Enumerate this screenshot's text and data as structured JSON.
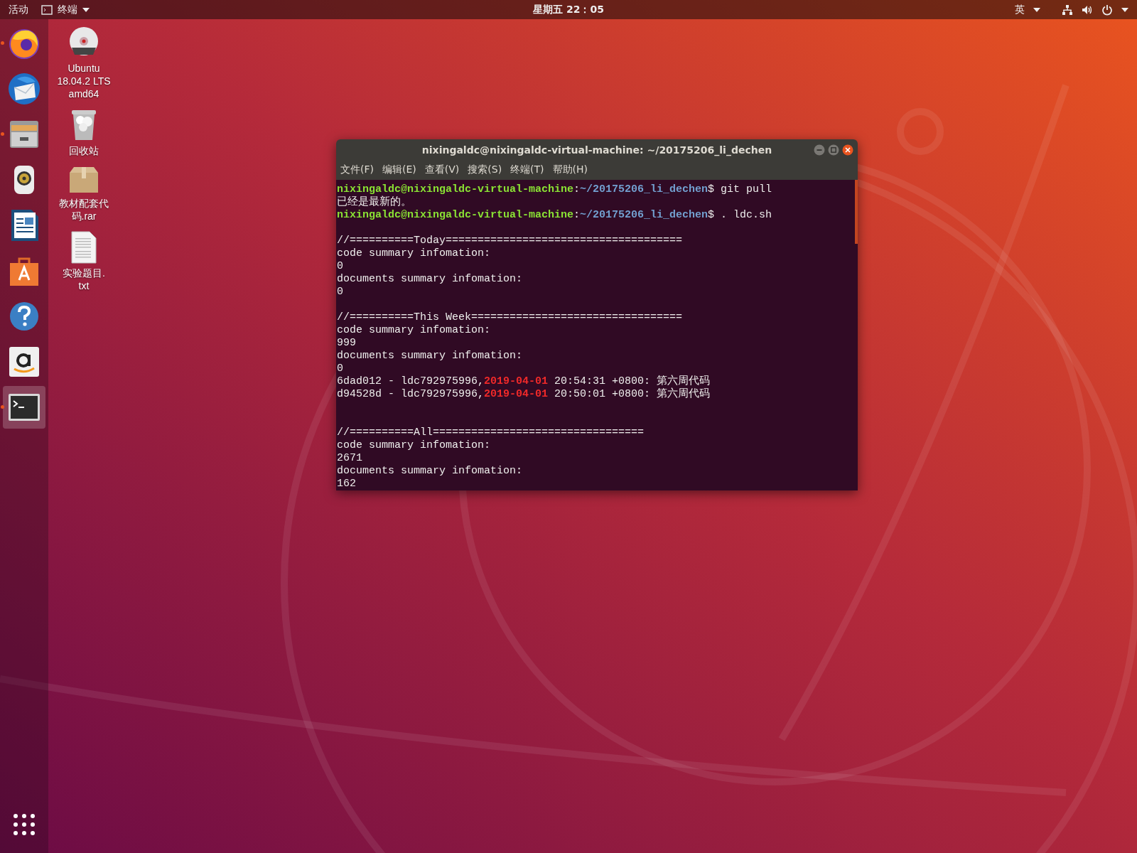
{
  "top_bar": {
    "activities": "活动",
    "app_menu": "终端",
    "clock": "星期五 22：05",
    "input_method": "英"
  },
  "dock": {
    "items": [
      {
        "kind": "browser",
        "running": true,
        "selected": false
      },
      {
        "kind": "mail",
        "running": false,
        "selected": false
      },
      {
        "kind": "files",
        "running": true,
        "selected": false
      },
      {
        "kind": "music",
        "running": false,
        "selected": false
      },
      {
        "kind": "writer",
        "running": false,
        "selected": false
      },
      {
        "kind": "store",
        "running": false,
        "selected": false
      },
      {
        "kind": "help",
        "running": false,
        "selected": false
      },
      {
        "kind": "shop",
        "running": false,
        "selected": false
      },
      {
        "kind": "terminal",
        "running": true,
        "selected": true
      }
    ]
  },
  "desktop_icons": [
    {
      "kind": "disc",
      "label": "Ubuntu\n18.04.2 LTS\namd64"
    },
    {
      "kind": "trash",
      "label": "回收站"
    },
    {
      "kind": "archive",
      "label": "教材配套代码.rar"
    },
    {
      "kind": "document",
      "label": "实验题目.\ntxt"
    }
  ],
  "terminal": {
    "title": "nixingaldc@nixingaldc-virtual-machine: ~/20175206_li_dechen",
    "menu": [
      "文件(F)",
      "编辑(E)",
      "查看(V)",
      "搜索(S)",
      "终端(T)",
      "帮助(H)"
    ],
    "lines": [
      {
        "kind": "text",
        "segments": [
          {
            "kind": "user",
            "text": "nixingaldc@nixingaldc-virtual-machine"
          },
          {
            "kind": "plain",
            "text": ":"
          },
          {
            "kind": "path",
            "text": "~/20175206_li_dechen"
          },
          {
            "kind": "plain",
            "text": "$ git pull"
          }
        ]
      },
      {
        "kind": "text",
        "segments": [
          {
            "kind": "plain",
            "text": "已经是最新的。"
          }
        ]
      },
      {
        "kind": "text",
        "segments": [
          {
            "kind": "user",
            "text": "nixingaldc@nixingaldc-virtual-machine"
          },
          {
            "kind": "plain",
            "text": ":"
          },
          {
            "kind": "path",
            "text": "~/20175206_li_dechen"
          },
          {
            "kind": "plain",
            "text": "$ . ldc.sh"
          }
        ]
      },
      {
        "kind": "blank"
      },
      {
        "kind": "text",
        "segments": [
          {
            "kind": "plain",
            "text": "//==========Today====================================="
          }
        ]
      },
      {
        "kind": "text",
        "segments": [
          {
            "kind": "plain",
            "text": "code summary infomation:"
          }
        ]
      },
      {
        "kind": "text",
        "segments": [
          {
            "kind": "plain",
            "text": "0"
          }
        ]
      },
      {
        "kind": "text",
        "segments": [
          {
            "kind": "plain",
            "text": "documents summary infomation:"
          }
        ]
      },
      {
        "kind": "text",
        "segments": [
          {
            "kind": "plain",
            "text": "0"
          }
        ]
      },
      {
        "kind": "blank"
      },
      {
        "kind": "text",
        "segments": [
          {
            "kind": "plain",
            "text": "//==========This Week================================="
          }
        ]
      },
      {
        "kind": "text",
        "segments": [
          {
            "kind": "plain",
            "text": "code summary infomation:"
          }
        ]
      },
      {
        "kind": "text",
        "segments": [
          {
            "kind": "plain",
            "text": "999"
          }
        ]
      },
      {
        "kind": "text",
        "segments": [
          {
            "kind": "plain",
            "text": "documents summary infomation:"
          }
        ]
      },
      {
        "kind": "text",
        "segments": [
          {
            "kind": "plain",
            "text": "0"
          }
        ]
      },
      {
        "kind": "text",
        "segments": [
          {
            "kind": "plain",
            "text": "6dad012 - ldc792975996,"
          },
          {
            "kind": "date",
            "text": "2019-04-01"
          },
          {
            "kind": "plain",
            "text": " 20:54:31 +0800: 第六周代码"
          }
        ]
      },
      {
        "kind": "text",
        "segments": [
          {
            "kind": "plain",
            "text": "d94528d - ldc792975996,"
          },
          {
            "kind": "date",
            "text": "2019-04-01"
          },
          {
            "kind": "plain",
            "text": " 20:50:01 +0800: 第六周代码"
          }
        ]
      },
      {
        "kind": "blank"
      },
      {
        "kind": "blank"
      },
      {
        "kind": "text",
        "segments": [
          {
            "kind": "plain",
            "text": "//==========All================================="
          }
        ]
      },
      {
        "kind": "text",
        "segments": [
          {
            "kind": "plain",
            "text": "code summary infomation:"
          }
        ]
      },
      {
        "kind": "text",
        "segments": [
          {
            "kind": "plain",
            "text": "2671"
          }
        ]
      },
      {
        "kind": "text",
        "segments": [
          {
            "kind": "plain",
            "text": "documents summary infomation:"
          }
        ]
      },
      {
        "kind": "text",
        "segments": [
          {
            "kind": "plain",
            "text": "162"
          }
        ]
      }
    ]
  }
}
